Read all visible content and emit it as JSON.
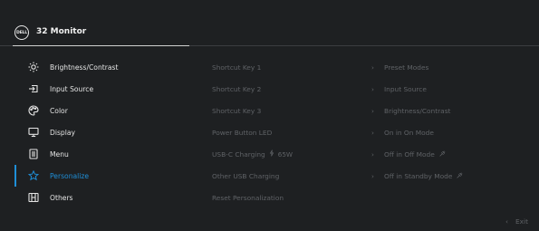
{
  "header": {
    "brand": "DELL",
    "title": "32 Monitor"
  },
  "colors": {
    "background": "#1e2022",
    "accent": "#1f8fd8",
    "dim_text": "#5f6266",
    "text": "#e4e4e4"
  },
  "menu": {
    "active_index": 5,
    "items": [
      {
        "label": "Brightness/Contrast",
        "icon": "brightness-icon"
      },
      {
        "label": "Input Source",
        "icon": "input-source-icon"
      },
      {
        "label": "Color",
        "icon": "palette-icon"
      },
      {
        "label": "Display",
        "icon": "display-icon"
      },
      {
        "label": "Menu",
        "icon": "menu-icon"
      },
      {
        "label": "Personalize",
        "icon": "star-icon"
      },
      {
        "label": "Others",
        "icon": "others-icon"
      }
    ]
  },
  "submenu": {
    "items": [
      {
        "label": "Shortcut Key 1"
      },
      {
        "label": "Shortcut Key 2"
      },
      {
        "label": "Shortcut Key 3"
      },
      {
        "label": "Power Button LED"
      },
      {
        "label": "USB-C Charging",
        "extra": "65W"
      },
      {
        "label": "Other USB Charging"
      },
      {
        "label": "Reset Personalization"
      }
    ]
  },
  "values": {
    "items": [
      {
        "label": "Preset Modes"
      },
      {
        "label": "Input Source"
      },
      {
        "label": "Brightness/Contrast"
      },
      {
        "label": "On in On Mode"
      },
      {
        "label": "Off in Off Mode"
      },
      {
        "label": "Off in Standby Mode"
      }
    ]
  },
  "footer": {
    "exit_label": "Exit"
  }
}
